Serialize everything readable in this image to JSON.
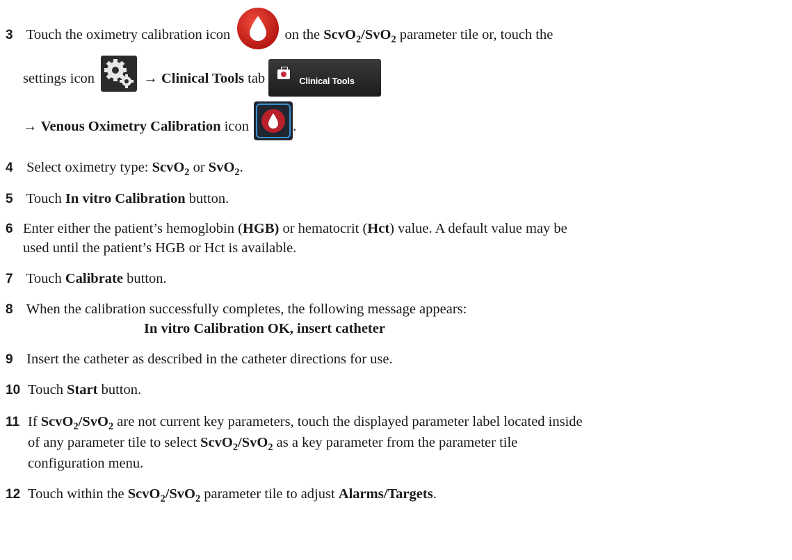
{
  "steps": [
    {
      "num": "3",
      "line1_a": "Touch the oximetry calibration icon",
      "line1_b": "on the",
      "line1_b2": "parameter tile or, touch the",
      "line2_a": "settings icon",
      "line2_arrow": "→",
      "line2_bold": "Clinical Tools",
      "line2_b": "tab",
      "tab_label": "Clinical Tools",
      "line3_arrow": "→",
      "line3_bold": "Venous Oximetry Calibration",
      "line3_b": "icon",
      "line3_end": "."
    },
    {
      "num": "4",
      "a": "Select oximetry type:",
      "mid": "or",
      "end": "."
    },
    {
      "num": "5",
      "a": "Touch",
      "bold": "In vitro Calibration",
      "b": "button."
    },
    {
      "num": "6",
      "a": "Enter either the patient’s hemoglobin (",
      "bold1": "HGB)",
      "b": "or hematocrit (",
      "bold2": "Hct",
      "c": ") value. A default value may be",
      "line2": "used until the patient’s HGB or Hct is available."
    },
    {
      "num": "7",
      "a": "Touch",
      "bold": "Calibrate",
      "b": "button."
    },
    {
      "num": "8",
      "a": "When the calibration successfully completes, the following message appears:",
      "message": "In vitro Calibration OK, insert catheter"
    },
    {
      "num": "9",
      "a": "Insert the catheter as described in the catheter directions for use."
    },
    {
      "num": "10",
      "a": "Touch",
      "bold": "Start",
      "b": "button."
    },
    {
      "num": "11",
      "a": "If",
      "b": "are not current key parameters, touch the displayed parameter label located inside",
      "line2_a": "of any parameter tile to select",
      "line2_b": "as a key parameter from the parameter tile",
      "line3": "configuration menu."
    },
    {
      "num": "12",
      "a": "Touch within the",
      "b": "parameter tile to adjust",
      "bold": "Alarms/Targets",
      "end": "."
    }
  ],
  "terms": {
    "scv": "ScvO",
    "sv": "SvO",
    "sub": "2",
    "slash": "/"
  },
  "colors": {
    "drop_red": "#cc1e1e",
    "tab_bg": "#2a2a2a",
    "venous_icon_border": "#3a8fd0"
  },
  "icons": [
    "oximetry-calibration-icon",
    "settings-gear-icon",
    "clinical-tools-tab-icon",
    "venous-oximetry-calibration-icon"
  ]
}
